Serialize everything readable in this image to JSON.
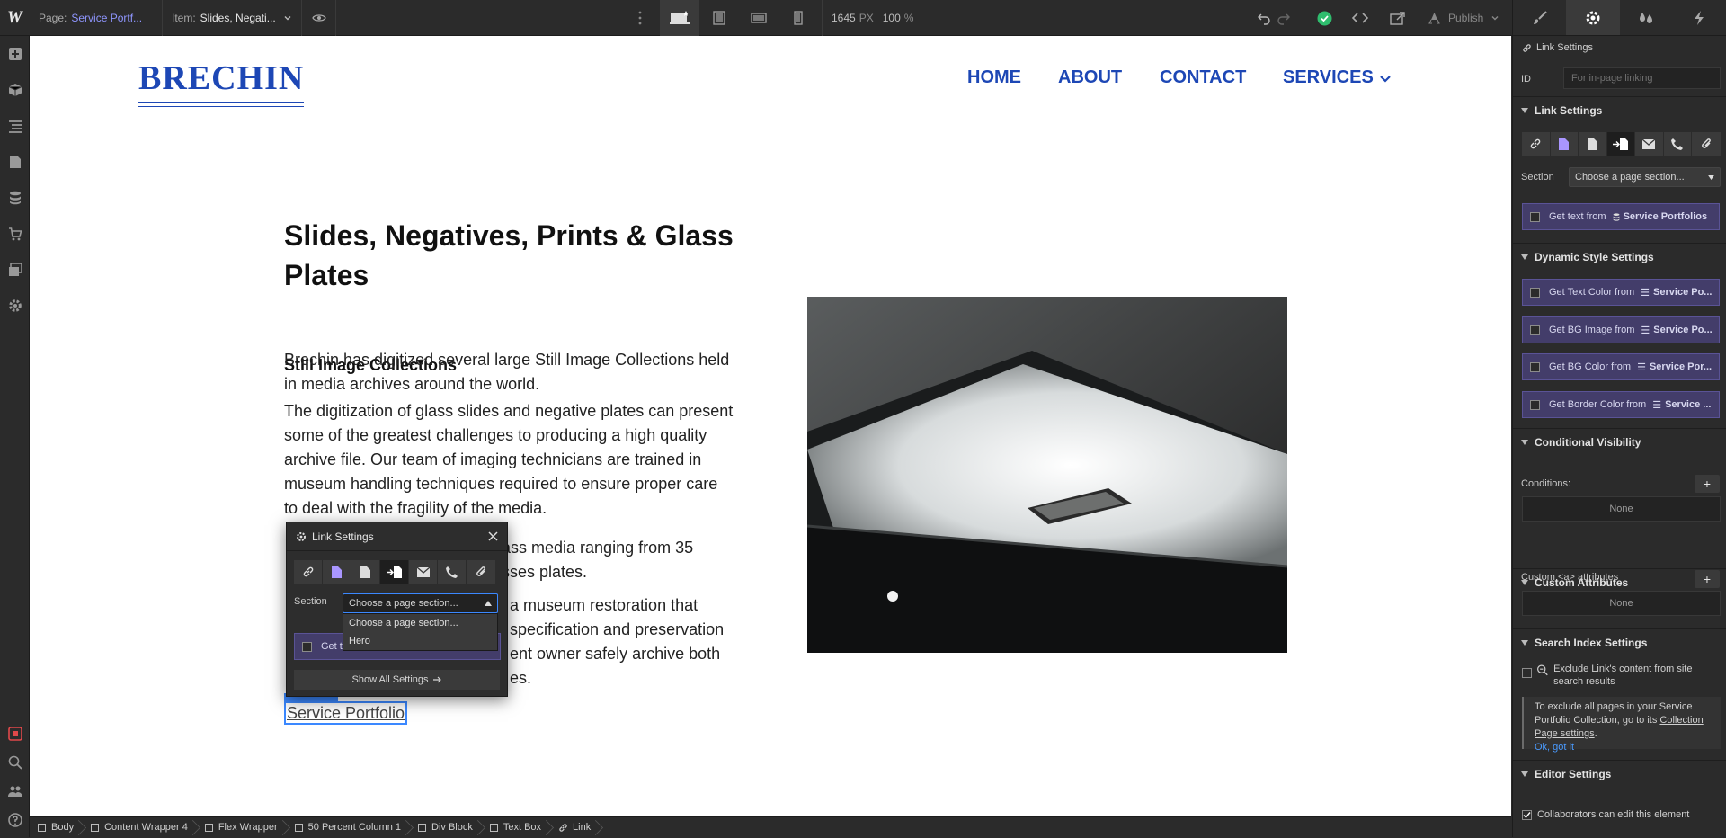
{
  "topbar": {
    "logo": "W",
    "page_key": "Page:",
    "page_value": "Service Portf...",
    "item_key": "Item:",
    "item_value": "Slides, Negati...",
    "width_value": "1645",
    "width_unit": "PX",
    "zoom_value": "100",
    "zoom_unit": "%",
    "publish_label": "Publish"
  },
  "site": {
    "brand": "BRECHIN",
    "nav": [
      "HOME",
      "ABOUT",
      "CONTACT",
      "SERVICES"
    ],
    "heading": "Slides, Negatives, Prints & Glass Plates",
    "subheading": "Still Image Collections",
    "para1": "Brechin has digitized several large Still Image Collections held in media archives around the world.",
    "para2": "The digitization of glass slides and negative plates can present some of the greatest challenges to producing a high quality archive file. Our team of imaging technicians are trained in museum handling techniques required to ensure proper care to deal with the fragility of the media.",
    "para3_visible": "ass media ranging from 35",
    "para3_line2": "sses plates.",
    "para4_line1": "a museum restoration that",
    "para4_line2": "specification and preservation",
    "para4_line3": "ent owner safely archive both",
    "para4_line4": "es.",
    "link_text": "Service Portfolio"
  },
  "popup": {
    "title": "Link Settings",
    "section_label": "Section",
    "select_value": "Choose a page section...",
    "options": [
      "Choose a page section...",
      "Hero"
    ],
    "get_text_partial": "Get t",
    "show_all": "Show All Settings"
  },
  "right_panel": {
    "header": "Link Settings",
    "id_label": "ID",
    "id_placeholder": "For in-page linking",
    "link_settings_title": "Link Settings",
    "section_label": "Section",
    "section_value": "Choose a page section...",
    "get_text": "Get text from",
    "get_text_source": "Service Portfolios",
    "dynamic_title": "Dynamic Style Settings",
    "dynamic_items": [
      {
        "label": "Get Text Color from",
        "source": "Service Po..."
      },
      {
        "label": "Get BG Image from",
        "source": "Service Po..."
      },
      {
        "label": "Get BG Color from",
        "source": "Service Por..."
      },
      {
        "label": "Get Border Color from",
        "source": "Service ..."
      }
    ],
    "cond_title": "Conditional Visibility",
    "conditions_label": "Conditions:",
    "none": "None",
    "custom_title": "Custom Attributes",
    "custom_label": "Custom <a> attributes",
    "search_title": "Search Index Settings",
    "exclude_label": "Exclude Link's content from site search results",
    "info_text": "To exclude all pages in your Service Portfolio Collection, go to its",
    "info_link": "Collection Page settings",
    "ok_link": "Ok, got it",
    "editor_title": "Editor Settings",
    "collab_label": "Collaborators can edit this element"
  },
  "breadcrumbs": [
    "Body",
    "Content Wrapper 4",
    "Flex Wrapper",
    "50 Percent Column 1",
    "Div Block",
    "Text Box",
    "Link"
  ],
  "colors": {
    "accent": "#3b88ff",
    "brand": "#1d47b5",
    "purple": "#433d6a",
    "success": "#2fbd6e"
  }
}
